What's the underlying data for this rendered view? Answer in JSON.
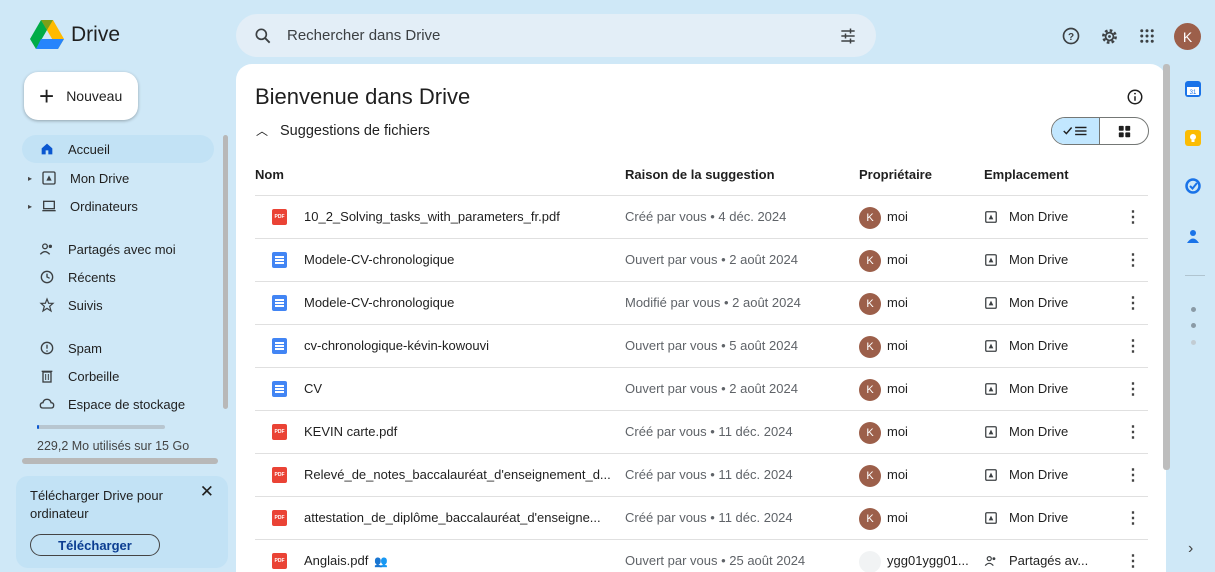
{
  "app": {
    "name": "Drive"
  },
  "search": {
    "placeholder": "Rechercher dans Drive"
  },
  "user": {
    "initial": "K",
    "avatar_color": "#9c5f4a"
  },
  "new_button": {
    "label": "Nouveau"
  },
  "sidebar": {
    "items": [
      {
        "label": "Accueil",
        "icon": "home-icon",
        "active": true
      },
      {
        "label": "Mon Drive",
        "icon": "drive-icon",
        "expandable": true
      },
      {
        "label": "Ordinateurs",
        "icon": "computer-icon",
        "expandable": true
      },
      {
        "label": "Partagés avec moi",
        "icon": "people-icon"
      },
      {
        "label": "Récents",
        "icon": "clock-icon"
      },
      {
        "label": "Suivis",
        "icon": "star-icon"
      },
      {
        "label": "Spam",
        "icon": "spam-icon"
      },
      {
        "label": "Corbeille",
        "icon": "trash-icon"
      },
      {
        "label": "Espace de stockage",
        "icon": "cloud-icon"
      }
    ],
    "storage_text": "229,2 Mo utilisés sur 15 Go",
    "storage_fraction": 0.015
  },
  "promo": {
    "text": "Télécharger Drive pour ordinateur",
    "button": "Télécharger",
    "close": "✕"
  },
  "main": {
    "title": "Bienvenue dans Drive",
    "section": "Suggestions de fichiers",
    "columns": {
      "name": "Nom",
      "reason": "Raison de la suggestion",
      "owner": "Propriétaire",
      "location": "Emplacement"
    },
    "files": [
      {
        "type": "pdf",
        "name": "10_2_Solving_tasks_with_parameters_fr.pdf",
        "reason": "Créé par vous • 4 déc. 2024",
        "owner": "moi",
        "owner_initial": "K",
        "location": "Mon Drive"
      },
      {
        "type": "doc",
        "name": "Modele-CV-chronologique",
        "reason": "Ouvert par vous • 2 août 2024",
        "owner": "moi",
        "owner_initial": "K",
        "location": "Mon Drive"
      },
      {
        "type": "doc",
        "name": "Modele-CV-chronologique",
        "reason": "Modifié par vous • 2 août 2024",
        "owner": "moi",
        "owner_initial": "K",
        "location": "Mon Drive"
      },
      {
        "type": "doc",
        "name": "cv-chronologique-kévin-kowouvi",
        "reason": "Ouvert par vous • 5 août 2024",
        "owner": "moi",
        "owner_initial": "K",
        "location": "Mon Drive"
      },
      {
        "type": "doc",
        "name": "CV",
        "reason": "Ouvert par vous • 2 août 2024",
        "owner": "moi",
        "owner_initial": "K",
        "location": "Mon Drive"
      },
      {
        "type": "pdf",
        "name": "KEVIN carte.pdf",
        "reason": "Créé par vous • 11 déc. 2024",
        "owner": "moi",
        "owner_initial": "K",
        "location": "Mon Drive"
      },
      {
        "type": "pdf",
        "name": "Relevé_de_notes_baccalauréat_d'enseignement_d...",
        "reason": "Créé par vous • 11 déc. 2024",
        "owner": "moi",
        "owner_initial": "K",
        "location": "Mon Drive"
      },
      {
        "type": "pdf",
        "name": "attestation_de_diplôme_baccalauréat_d'enseigne...",
        "reason": "Créé par vous • 11 déc. 2024",
        "owner": "moi",
        "owner_initial": "K",
        "location": "Mon Drive"
      },
      {
        "type": "pdf",
        "name": "Anglais.pdf",
        "shared": true,
        "reason": "Ouvert par vous • 25 août 2024",
        "owner": "ygg01ygg01...",
        "owner_initial": "",
        "location": "Partagés av..."
      }
    ]
  }
}
